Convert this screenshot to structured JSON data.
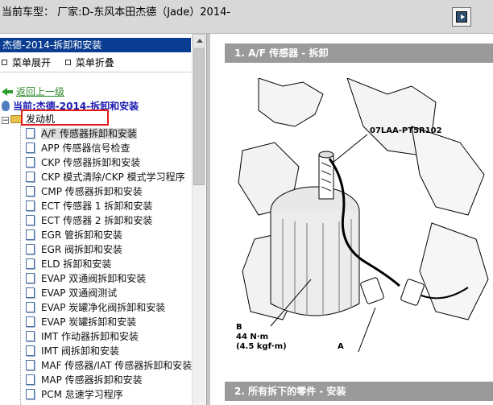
{
  "titlebar": {
    "title": "当前车型：  厂家:D-东风本田杰德（Jade）2014-",
    "nav_icon": "exit-arrow-icon"
  },
  "sidebar": {
    "header": "杰德-2014-拆卸和安装",
    "expand_label": "菜单展开",
    "collapse_label": "菜单折叠",
    "back_label": "返回上一级",
    "current_label": "当前:杰德-2014-拆卸和安装",
    "engine_label": "发动机",
    "items": [
      "A/F 传感器拆卸和安装",
      "APP 传感器信号检查",
      "CKP 传感器拆卸和安装",
      "CKP 模式清除/CKP 模式学习程序",
      "CMP 传感器拆卸和安装",
      "ECT 传感器 1 拆卸和安装",
      "ECT 传感器 2 拆卸和安装",
      "EGR 管拆卸和安装",
      "EGR 阀拆卸和安装",
      "ELD 拆卸和安装",
      "EVAP 双通阀拆卸和安装",
      "EVAP 双通阀测试",
      "EVAP 炭罐净化阀拆卸和安装",
      "EVAP 炭罐拆卸和安装",
      "IMT 作动器拆卸和安装",
      "IMT 阀拆卸和安装",
      "MAF 传感器/IAT 传感器拆卸和安装",
      "MAP 传感器拆卸和安装",
      "PCM 怠速学习程序"
    ],
    "selected_index": 0
  },
  "content": {
    "section1_title": "1. A/F 传感器 - 拆卸",
    "section2_title": "2. 所有拆下的零件 - 安装",
    "diagram": {
      "tool_code": "07LAA-PT5R102",
      "label_b": "B",
      "torque_nm": "44 N·m",
      "torque_kgf": "(4.5 kgf·m)",
      "label_a": "A"
    }
  },
  "colors": {
    "header_blue": "#0a3d91",
    "section_gray": "#9a9a9a",
    "highlight_red": "#e21b1b",
    "link_green": "#2c8a2c"
  }
}
